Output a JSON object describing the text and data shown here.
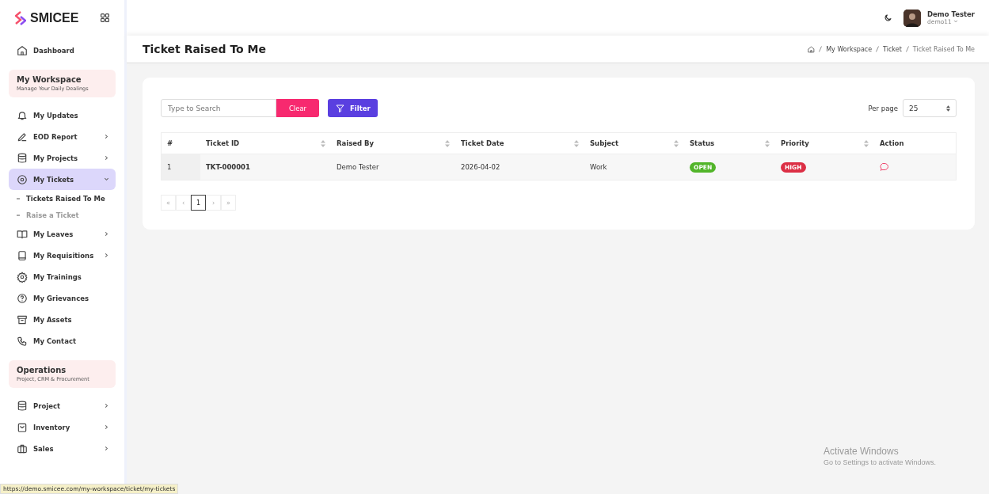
{
  "brand": {
    "name": "SMICEE"
  },
  "sidebar": {
    "items": [
      {
        "kind": "link",
        "label": "Dashboard",
        "expandable": false,
        "selected": false
      },
      {
        "kind": "section",
        "title": "My Workspace",
        "subtitle": "Manage Your Daily Dealings"
      },
      {
        "kind": "link",
        "label": "My Updates",
        "expandable": false,
        "selected": false
      },
      {
        "kind": "link",
        "label": "EOD Report",
        "expandable": true,
        "selected": false
      },
      {
        "kind": "link",
        "label": "My Projects",
        "expandable": true,
        "selected": false
      },
      {
        "kind": "link",
        "label": "My Tickets",
        "expandable": true,
        "selected": true,
        "expanded": true,
        "children": [
          {
            "label": "Tickets Raised To Me",
            "selected": true
          },
          {
            "label": "Raise a Ticket",
            "selected": false
          }
        ]
      },
      {
        "kind": "link",
        "label": "My Leaves",
        "expandable": true,
        "selected": false
      },
      {
        "kind": "link",
        "label": "My Requisitions",
        "expandable": true,
        "selected": false
      },
      {
        "kind": "link",
        "label": "My Trainings",
        "expandable": false,
        "selected": false
      },
      {
        "kind": "link",
        "label": "My Grievances",
        "expandable": false,
        "selected": false
      },
      {
        "kind": "link",
        "label": "My Assets",
        "expandable": false,
        "selected": false
      },
      {
        "kind": "link",
        "label": "My Contact",
        "expandable": false,
        "selected": false
      },
      {
        "kind": "section",
        "title": "Operations",
        "subtitle": "Project, CRM & Procurement"
      },
      {
        "kind": "link",
        "label": "Project",
        "expandable": true,
        "selected": false
      },
      {
        "kind": "link",
        "label": "Inventory",
        "expandable": true,
        "selected": false
      },
      {
        "kind": "link",
        "label": "Sales",
        "expandable": true,
        "selected": false
      }
    ]
  },
  "header": {
    "user_name": "Demo Tester",
    "user_id": "demo11"
  },
  "page_title": "Ticket Raised To Me",
  "breadcrumb": [
    "My Workspace",
    "Ticket",
    "Ticket Raised To Me"
  ],
  "search": {
    "placeholder": "Type to Search"
  },
  "clear_button": "Clear",
  "filter_button": "Filter",
  "per_page": {
    "label": "Per page",
    "value": "25"
  },
  "table": {
    "columns": [
      {
        "label": "#",
        "sortable": false
      },
      {
        "label": "Ticket ID",
        "sortable": true
      },
      {
        "label": "Raised By",
        "sortable": true
      },
      {
        "label": "Ticket Date",
        "sortable": true
      },
      {
        "label": "Subject",
        "sortable": true
      },
      {
        "label": "Status",
        "sortable": true
      },
      {
        "label": "Priority",
        "sortable": true
      },
      {
        "label": "Action",
        "sortable": false
      }
    ],
    "rows": [
      {
        "number": "1",
        "ticket_id": "TKT-000001",
        "raised_by": "Demo Tester",
        "ticket_date": "2026-04-02",
        "subject": "Work",
        "status": {
          "label": "OPEN",
          "color": "#52b52a"
        },
        "priority": {
          "label": "HIGH",
          "color": "#dc2f45"
        }
      }
    ]
  },
  "pagination": {
    "first": "«",
    "prev": "‹",
    "pages": [
      {
        "label": "1",
        "selected": true
      }
    ],
    "next": "›",
    "last": "»"
  },
  "status_url": "https://demo.smicee.com/my-workspace/ticket/my-tickets",
  "os_watermark": {
    "title": "Activate Windows",
    "subtitle": "Go to Settings to activate Windows."
  }
}
